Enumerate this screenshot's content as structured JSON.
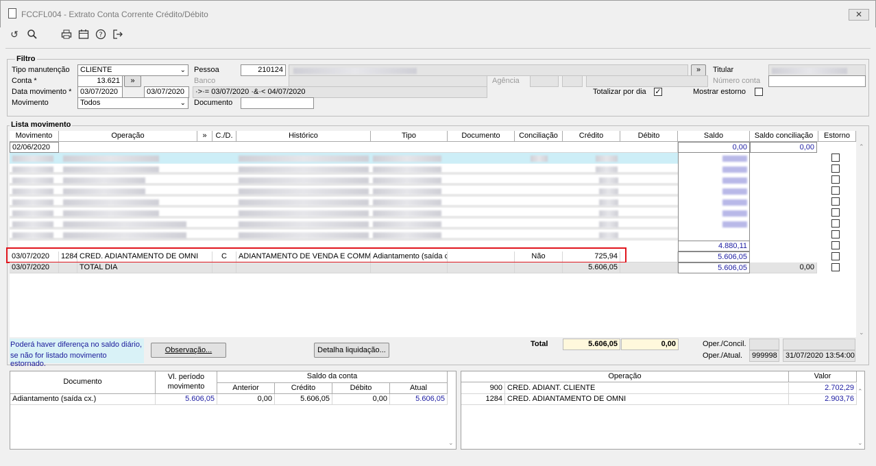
{
  "window": {
    "title": "FCCFL004 - Extrato Conta Corrente Crédito/Débito",
    "close": "✕"
  },
  "toolbar": {
    "icons": [
      "undo-icon",
      "search-icon",
      "print-icon",
      "calendar-icon",
      "help-icon",
      "exit-icon"
    ]
  },
  "filtro": {
    "legend": "Filtro",
    "tipo_manutencao_label": "Tipo manutenção",
    "tipo_manutencao_value": "CLIENTE",
    "conta_label": "Conta *",
    "conta_value": "13.621",
    "data_mov_label": "Data movimento *",
    "data_from": "03/07/2020",
    "data_to": "03/07/2020",
    "data_expr": "·>·= 03/07/2020 ·&·< 04/07/2020",
    "movimento_label": "Movimento",
    "movimento_value": "Todos",
    "pessoa_label": "Pessoa",
    "pessoa_value": "210124",
    "banco_label": "Banco",
    "agencia_label": "Agência",
    "documento_label": "Documento",
    "titular_label": "Titular",
    "numero_conta_label": "Número conta",
    "totalizar_label": "Totalizar por dia",
    "totalizar_checked": true,
    "mostrar_estorno_label": "Mostrar estorno",
    "mostrar_estorno_checked": false,
    "expand_btn": "»"
  },
  "lista": {
    "legend": "Lista movimento",
    "columns": [
      "Movimento",
      "Operação",
      "»",
      "C./D.",
      "Histórico",
      "Tipo",
      "Documento",
      "Conciliação",
      "Crédito",
      "Débito",
      "Saldo",
      "Saldo conciliação",
      "Estorno"
    ],
    "opening": {
      "date": "02/06/2020",
      "saldo": "0,00",
      "saldo_conc": "0,00"
    },
    "blurred_saldo_last": "4.880,11",
    "highlight": {
      "date": "03/07/2020",
      "code": "1284",
      "operacao": "CRED. ADIANTAMENTO DE OMNI",
      "cd": "C",
      "historico": "ADIANTAMENTO DE VENDA E COMMERCE",
      "tipo": "Adiantamento (saída cx.)",
      "conciliacao": "Não",
      "credito": "725,94",
      "saldo": "5.606,05"
    },
    "total_row": {
      "date": "03/07/2020",
      "label": "TOTAL DIA",
      "credito": "5.606,05",
      "saldo": "5.606,05",
      "saldo_conc": "0,00"
    }
  },
  "footer": {
    "note_line1": "Poderá haver diferença no saldo diário,",
    "note_line2": "se não for listado movimento estornado.",
    "observacao_btn": "Observação...",
    "detalha_btn": "Detalha liquidação...",
    "total_label": "Total",
    "total_credito": "5.606,05",
    "total_debito": "0,00",
    "oper_concil_label": "Oper./Concil.",
    "oper_atual_label": "Oper./Atual.",
    "oper_atual_user": "999998",
    "oper_atual_date": "31/07/2020 13:54:00"
  },
  "resumo": {
    "h_documento": "Documento",
    "h_vl_periodo": "Vl. período movimento",
    "h_saldo_conta": "Saldo da conta",
    "h_anterior": "Anterior",
    "h_credito": "Crédito",
    "h_debito": "Débito",
    "h_atual": "Atual",
    "row": {
      "documento": "Adiantamento (saída cx.)",
      "vl": "5.606,05",
      "anterior": "0,00",
      "credito": "5.606,05",
      "debito": "0,00",
      "atual": "5.606,05"
    }
  },
  "operacoes": {
    "h_operacao": "Operação",
    "h_valor": "Valor",
    "rows": [
      {
        "code": "900",
        "name": "CRED. ADIANT. CLIENTE",
        "valor": "2.702,29"
      },
      {
        "code": "1284",
        "name": "CRED. ADIANTAMENTO DE OMNI",
        "valor": "2.903,76"
      }
    ]
  }
}
